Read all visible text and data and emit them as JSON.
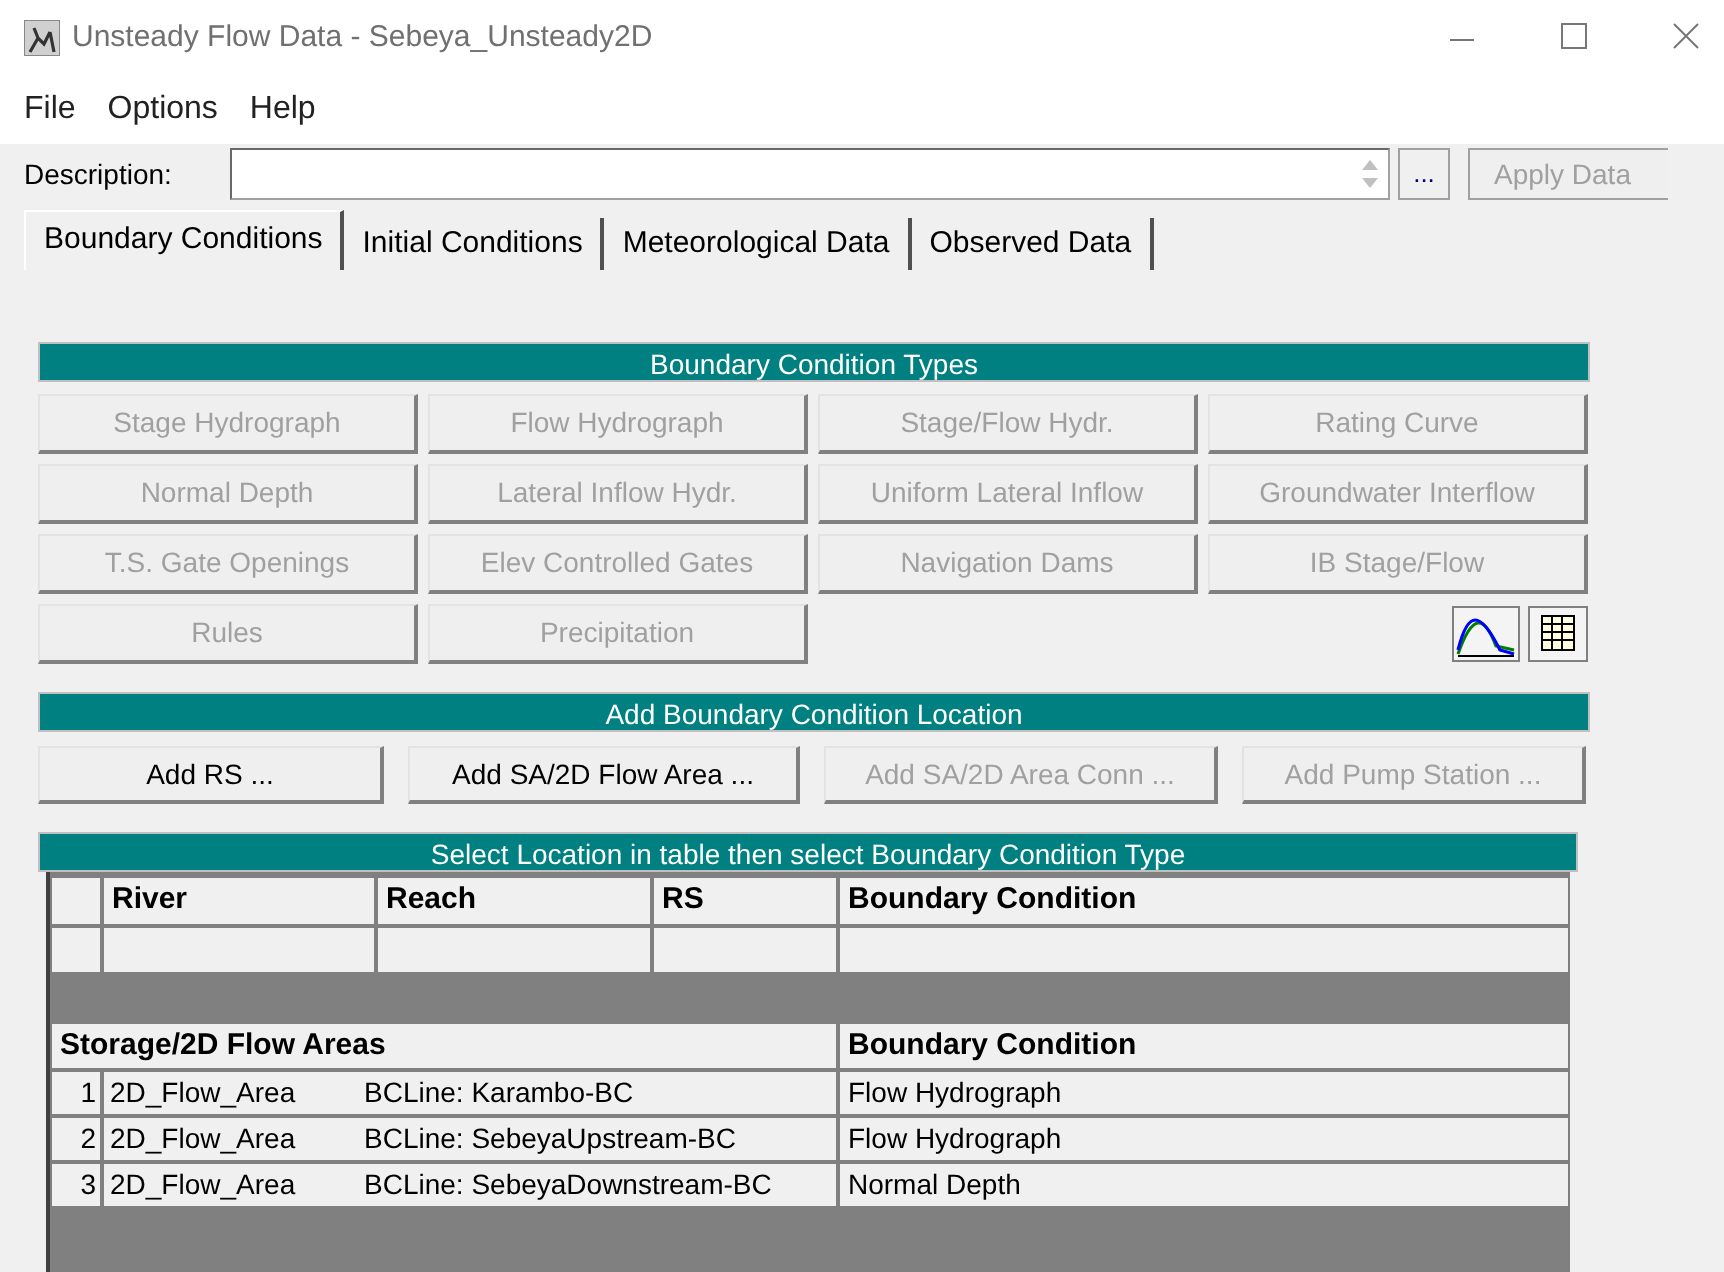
{
  "window": {
    "title": "Unsteady Flow Data - Sebeya_Unsteady2D"
  },
  "menu": [
    "File",
    "Options",
    "Help"
  ],
  "description": {
    "label": "Description:",
    "more": "...",
    "apply": "Apply Data"
  },
  "tabs": [
    {
      "label": "Boundary Conditions",
      "selected": true
    },
    {
      "label": "Initial Conditions",
      "selected": false
    },
    {
      "label": "Meteorological Data",
      "selected": false
    },
    {
      "label": "Observed Data",
      "selected": false
    }
  ],
  "types_title": "Boundary Condition Types",
  "types": [
    {
      "label": "Stage Hydrograph",
      "disabled": true
    },
    {
      "label": "Flow Hydrograph",
      "disabled": true
    },
    {
      "label": "Stage/Flow Hydr.",
      "disabled": true
    },
    {
      "label": "Rating Curve",
      "disabled": true
    },
    {
      "label": "Normal Depth",
      "disabled": true
    },
    {
      "label": "Lateral Inflow Hydr.",
      "disabled": true
    },
    {
      "label": "Uniform Lateral Inflow",
      "disabled": true
    },
    {
      "label": "Groundwater Interflow",
      "disabled": true
    },
    {
      "label": "T.S. Gate Openings",
      "disabled": true
    },
    {
      "label": "Elev Controlled Gates",
      "disabled": true
    },
    {
      "label": "Navigation Dams",
      "disabled": true
    },
    {
      "label": "IB Stage/Flow",
      "disabled": true
    },
    {
      "label": "Rules",
      "disabled": true
    },
    {
      "label": "Precipitation",
      "disabled": true
    }
  ],
  "location_title": "Add Boundary Condition Location",
  "location_buttons": [
    {
      "label": "Add RS ...",
      "disabled": false
    },
    {
      "label": "Add SA/2D Flow Area ...",
      "disabled": false
    },
    {
      "label": "Add SA/2D Area Conn ...",
      "disabled": true
    },
    {
      "label": "Add Pump Station ...",
      "disabled": true
    }
  ],
  "table_title": "Select Location in table then select Boundary Condition Type",
  "river_table": {
    "columns": [
      "River",
      "Reach",
      "RS",
      "Boundary Condition"
    ]
  },
  "area_table": {
    "columns": [
      "Storage/2D Flow Areas",
      "Boundary Condition"
    ],
    "rows": [
      {
        "index": "1",
        "area": "2D_Flow_Area",
        "line": "BCLine: Karambo-BC",
        "condition": "Flow Hydrograph"
      },
      {
        "index": "2",
        "area": "2D_Flow_Area",
        "line": "BCLine: SebeyaUpstream-BC",
        "condition": "Flow Hydrograph"
      },
      {
        "index": "3",
        "area": "2D_Flow_Area",
        "line": "BCLine: SebeyaDownstream-BC",
        "condition": "Normal Depth"
      }
    ]
  }
}
